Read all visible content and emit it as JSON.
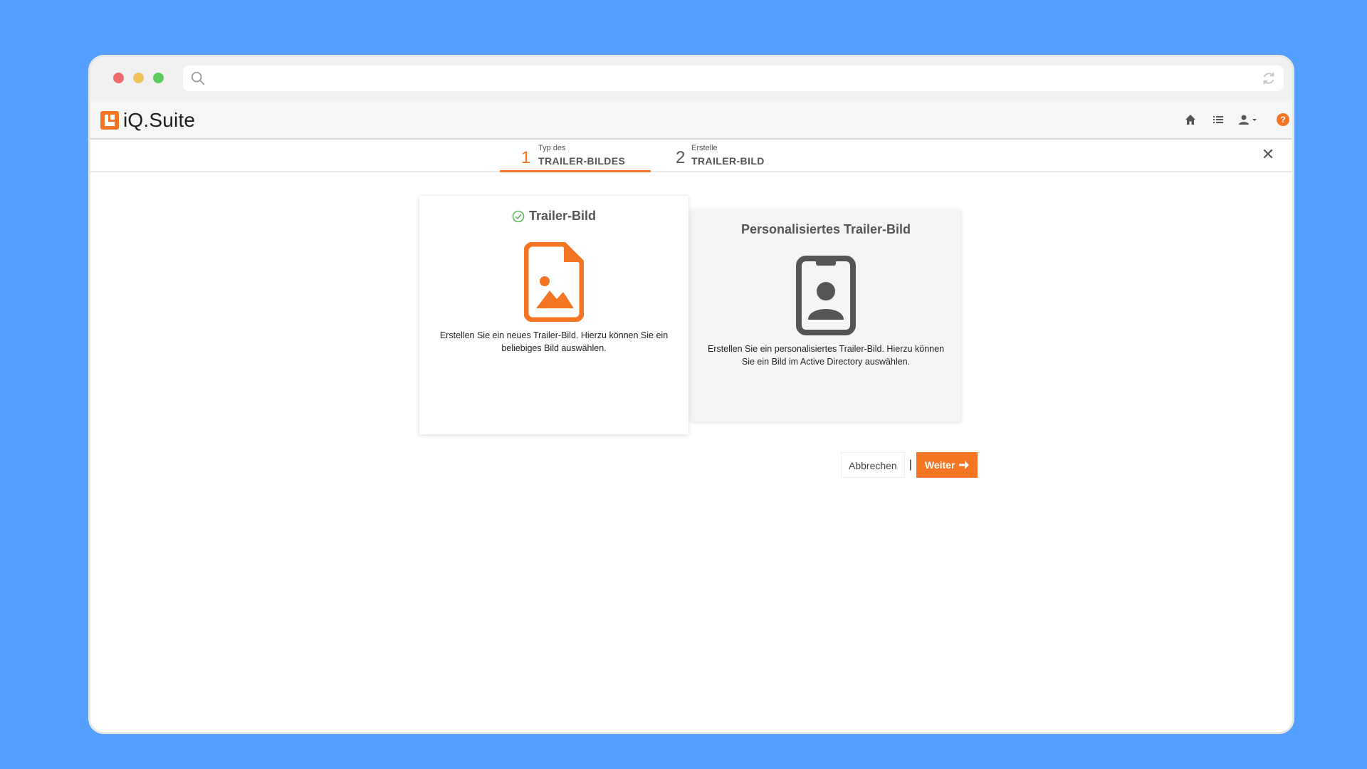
{
  "app": {
    "name": "iQ.Suite"
  },
  "colors": {
    "accent": "#f47624",
    "background": "#559ffe",
    "text": "#555555",
    "icon_gray": "#555555"
  },
  "browser": {
    "icons": [
      "search-icon",
      "reload-icon"
    ]
  },
  "nav": {
    "icons": [
      "home-icon",
      "list-icon",
      "user-menu-icon",
      "help-icon"
    ],
    "help_glyph": "?"
  },
  "wizard": {
    "steps": [
      {
        "number": "1",
        "small": "Typ des",
        "label": "TRAILER-BILDES",
        "active": true
      },
      {
        "number": "2",
        "small": "Erstelle",
        "label": "TRAILER-BILD",
        "active": false
      }
    ],
    "close_glyph": "✕"
  },
  "options": [
    {
      "title": "Trailer-Bild",
      "selected": true,
      "icon": "image-file-icon",
      "description": "Erstellen Sie ein neues Trailer-Bild. Hierzu können Sie ein beliebiges Bild auswählen."
    },
    {
      "title": "Personalisiertes Trailer-Bild",
      "selected": false,
      "icon": "id-badge-icon",
      "description": "Erstellen Sie ein personalisiertes Trailer-Bild. Hierzu können Sie ein Bild im Active Directory auswählen."
    }
  ],
  "actions": {
    "cancel": "Abbrechen",
    "separator": "|",
    "next": "Weiter"
  }
}
